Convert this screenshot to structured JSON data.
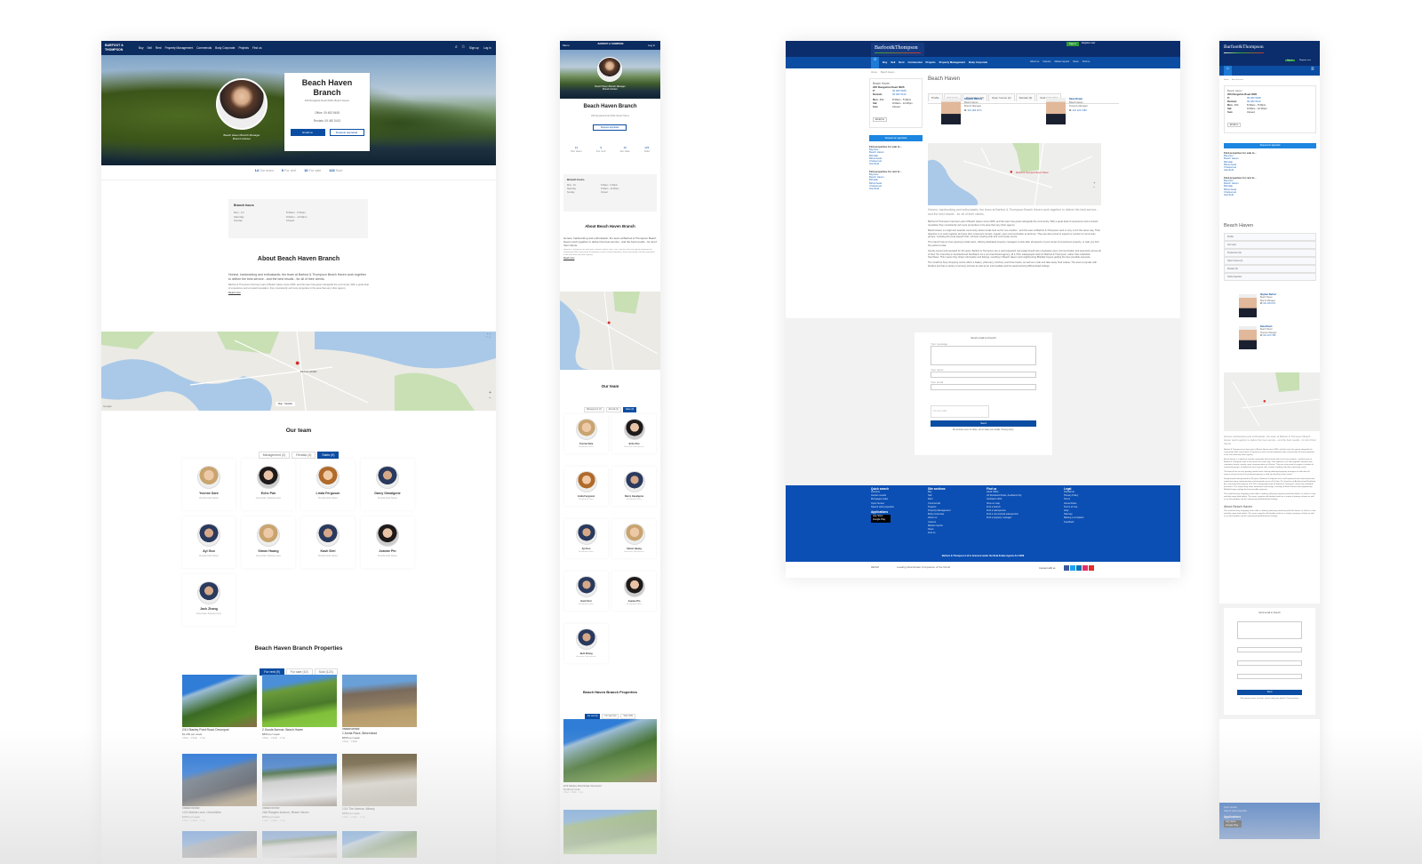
{
  "brand": {
    "logo_new": "BARFOOT & THOMPSON",
    "logo_old": "Barfoot&Thompson"
  },
  "colors": {
    "navy": "#0c2b5e",
    "brand_blue": "#0b4da2",
    "accent_green": "#2e9b3a"
  },
  "new_desktop": {
    "nav": {
      "items": [
        "Buy",
        "Sell",
        "Rent",
        "Property Management",
        "Commercial",
        "Body Corporate",
        "Projects",
        "Find us"
      ],
      "sign_up": "Sign up",
      "log_in": "Log in",
      "icons": [
        "search-icon",
        "star-icon"
      ]
    },
    "hero": {
      "title": "Beach Haven Branch",
      "address": "206 Rangatira Road 0626, Beach Haven",
      "office": "Office: 09 483 5408",
      "rentals": "Rentals: 09 482 5413",
      "email_button": "Email us",
      "appraisal_button": "Request appraisal",
      "staff_caption_1": "Beach Haven Branch Manager",
      "staff_caption_2": "Branch Adviser"
    },
    "stats": [
      {
        "value": "14",
        "label": "Our team"
      },
      {
        "value": "9",
        "label": "For rent"
      },
      {
        "value": "10",
        "label": "For sale"
      },
      {
        "value": "123",
        "label": "Sold"
      }
    ],
    "hours": {
      "title": "Branch hours",
      "rows": [
        {
          "day": "Mon - Fri",
          "time": "8:30am - 5:30pm"
        },
        {
          "day": "Saturday",
          "time": "9:00am - 12:00pm"
        },
        {
          "day": "Sunday",
          "time": "Closed"
        }
      ]
    },
    "about": {
      "title": "About Beach Haven Branch",
      "lead": "Honest, hardworking and enthusiastic, the team at Barfoot & Thompson Beach Haven work together to deliver the best service - and the best results - for all of their clients.",
      "body": "Barfoot & Thompson has been part of Beach Haven since 2005, and the team has grown alongside the community. With a great deal of experience and a trusted reputation, they consistently sell more properties in the area than any other agency.",
      "read_more": "Read more"
    },
    "map_labels": {
      "pin": "BEACH HAVEN",
      "map": "Map",
      "satellite": "Satellite",
      "google": "Google"
    },
    "team": {
      "title": "Our team",
      "tabs": [
        {
          "label": "Management (2)",
          "active": false
        },
        {
          "label": "Rentals (4)",
          "active": false
        },
        {
          "label": "Sales (9)",
          "active": true
        }
      ],
      "members": [
        {
          "name": "Yvonne Dare",
          "role": "Residential Sales"
        },
        {
          "name": "Echo Pan",
          "role": "Associate Salesperson"
        },
        {
          "name": "Linda Ferguson",
          "role": "Residential Sales"
        },
        {
          "name": "Darcy Gasalgone",
          "role": "Residential Sales"
        },
        {
          "name": "Ayi Guo",
          "role": "Residential Sales"
        },
        {
          "name": "Simon Huang",
          "role": "Associate Salesperson"
        },
        {
          "name": "Kash Sirri",
          "role": "Residential Sales"
        },
        {
          "name": "Joanne Pin",
          "role": "Residential Sales"
        },
        {
          "name": "Jack Zhang",
          "role": "Associate Salesperson"
        }
      ]
    },
    "properties": {
      "title": "Beach Haven Branch Properties",
      "tabs": [
        {
          "label": "For rent (9)",
          "active": true
        },
        {
          "label": "For sale (10)",
          "active": false
        },
        {
          "label": "Sold (123)",
          "active": false
        }
      ],
      "items": [
        {
          "badge": "",
          "address": "2/10 Stanley Point Road, Devonport",
          "price": "$1,200 per week",
          "features": "3 Bed · 2 Bath · 1 Car"
        },
        {
          "badge": "",
          "address": "2 Goode Avenue, Beach Haven",
          "price": "$800 per week",
          "features": "3 Bed · 1 Bath · 2 Car"
        },
        {
          "badge": "UNDER OFFER",
          "address": "1 Aroha Place, Birkenhead",
          "price": "$595 per week",
          "features": "2 Bed · 1 Bath"
        },
        {
          "badge": "UNDER OFFER",
          "address": "1/41 Marine Lane, Greenhithe",
          "price": "$780 per week",
          "features": "4 Bed · 2 Bath · 2 Car"
        },
        {
          "badge": "UNDER OFFER",
          "address": "26A Rangers Avenue, Beach Haven",
          "price": "$650 per week",
          "features": "3 Bed · 1 Bath · 1 Car"
        },
        {
          "badge": "",
          "address": "1/14 The Avenue, Albany",
          "price": "$495 per week",
          "features": "2 Bed · 1 Bath · 1 Car"
        }
      ]
    }
  },
  "new_mobile": {
    "menu": "Menu",
    "log_in": "Log in"
  },
  "old_desktop": {
    "sign_in": "Sign in",
    "register": "Register user",
    "nav": [
      "Buy",
      "Sell",
      "Rent",
      "Commercial",
      "Projects",
      "Property Management",
      "Body Corporate"
    ],
    "nav_right": [
      "About us",
      "Careers",
      "Market reports",
      "News",
      "Find us"
    ],
    "breadcrumb": [
      "Home",
      "Beach Haven"
    ],
    "sidebar": {
      "branch": "Beach Haven",
      "address": "206 Rangatira Road 0626",
      "phone_label": "P:",
      "phone": "09 483 5408",
      "rentals_label": "Rentals:",
      "rentals": "09 482 5413",
      "hours": [
        {
          "day": "Mon - Fri:",
          "time": "8:30am - 5:30pm"
        },
        {
          "day": "Sat:",
          "time": "9:00am - 12:00pm"
        },
        {
          "day": "Sun:",
          "time": "Closed"
        }
      ],
      "email_button": "Email us",
      "appraisal_button": "Request an appraisal",
      "sale_title": "Find properties for sale in...",
      "rent_title": "Find properties for rent in...",
      "suburbs": [
        "Bayview",
        "Beach Haven",
        "Birkdale",
        "Birkenhead",
        "Chatswood",
        "Glenfield"
      ]
    },
    "title": "Beach Haven",
    "tabs": [
      "Profile",
      "Our team",
      "Properties (12)",
      "Open homes (2)",
      "Rentals (9)",
      "Sold properties"
    ],
    "staff": [
      {
        "name": "Stephen Barfoot",
        "branch": "Beach Haven",
        "role": "Branch Manager",
        "m_label": "M:",
        "mobile": "021 283 0171"
      },
      {
        "name": "Dana Brown",
        "branch": "Beach Haven",
        "role": "Property Manager",
        "m_label": "M:",
        "mobile": "021 223 7380"
      }
    ],
    "map_pin": "Barfoot & Thompson Beach Haven",
    "lead": "Honest, hardworking and enthusiastic, the team at Barfoot & Thompson Beach Haven work together to deliver the best service - and the best results - for all of their clients.",
    "paragraphs": [
      "Barfoot & Thompson has been part of Beach Haven since 2005, and the team has grown alongside the community. With a great deal of experience and a trusted reputation they consistently sell more properties in the area than any other agency.",
      "Beach Haven is a tight-knit seaside community where locals look out for one another - and the team at Barfoot & Thompson work in very much the same way. Their objective is to work together and give their customers honest, regular, open communication at all times. They are also proud to support a number of community groups, including the local squash club, schools, bowling club and community centre.",
      "The branch has an ever-growing rentals team, offering dedicated property managers to look after all aspects of your tenant & investment property, or help you find the perfect rental.",
      "Family owned and operated for 93 years, Barfoot & Thompson are a well-respected real estate brand who emphasise open communication and teamwork across all of their 70+ branches in Auckland and Northland. As a non-franchised agency, all 1,700+ salespeople work for Barfoot & Thompson, rather than individual franchises. This means they share information and listings, resulting in Beach Haven and neighbouring Birkdale buyers getting the best possible exposure.",
      "The small but busy shopping centre offers a bakery, pharmacy, butchery and three banks, as well as a cafe and take-away food outlets. The area is popular with families and has a variety of primary schools as well as an intermediate and the award-winning Birkenhead College."
    ],
    "form": {
      "title": "Send email to branch",
      "message_label": "Your message",
      "name_label": "Your name",
      "email_label": "Your email",
      "phone_label": "Phone",
      "captcha": "I'm not a robot",
      "send": "Send",
      "note": "We promise never to share, sell or trade your details. Privacy policy."
    },
    "footer": {
      "quick_search_title": "Quick search",
      "quick_search": [
        "Auctions",
        "Auction results",
        "Mortgagee sales",
        "Open homes",
        "Search sold properties"
      ],
      "apps_title": "Applications",
      "app_store": "App Store",
      "google_play": "Google Play",
      "site_title": "Site sections",
      "site": [
        "Buy",
        "Sell",
        "Rent",
        "Commercial",
        "Projects",
        "Property Management",
        "Body Corporate",
        "About us",
        "Careers",
        "Market reports",
        "News",
        "Find us"
      ],
      "find_title": "Find us",
      "find": [
        "Head Office",
        "34 Shortland Street, Auckland City",
        "Auckland 1010",
        "View on map",
        "Find a branch",
        "Find a salesperson",
        "Find a commercial salesperson",
        "Find a property manager"
      ],
      "legal_title": "Legal",
      "legal": [
        "Disclaimer",
        "Privacy Policy",
        "Terms",
        "Home Rules",
        "Terms of Use",
        "Help",
        "Sitemap",
        "Making a complaint",
        "Feedback"
      ],
      "license": "Barfoot & Thompson Ltd is licensed under the Real Estate Agents Act 2008",
      "connect": "Connect with us",
      "social": [
        "facebook-icon",
        "twitter-icon",
        "linkedin-icon",
        "instagram-icon",
        "youtube-icon"
      ],
      "partners": [
        "REINZ",
        "Leading Real Estate Companies of the World"
      ]
    }
  },
  "old_mobile": {
    "about_title": "About Beach Haven",
    "vertical_tabs": [
      "Profile",
      "Our team",
      "Properties (12)",
      "Open homes (2)",
      "Rentals (9)",
      "Sold properties"
    ]
  }
}
